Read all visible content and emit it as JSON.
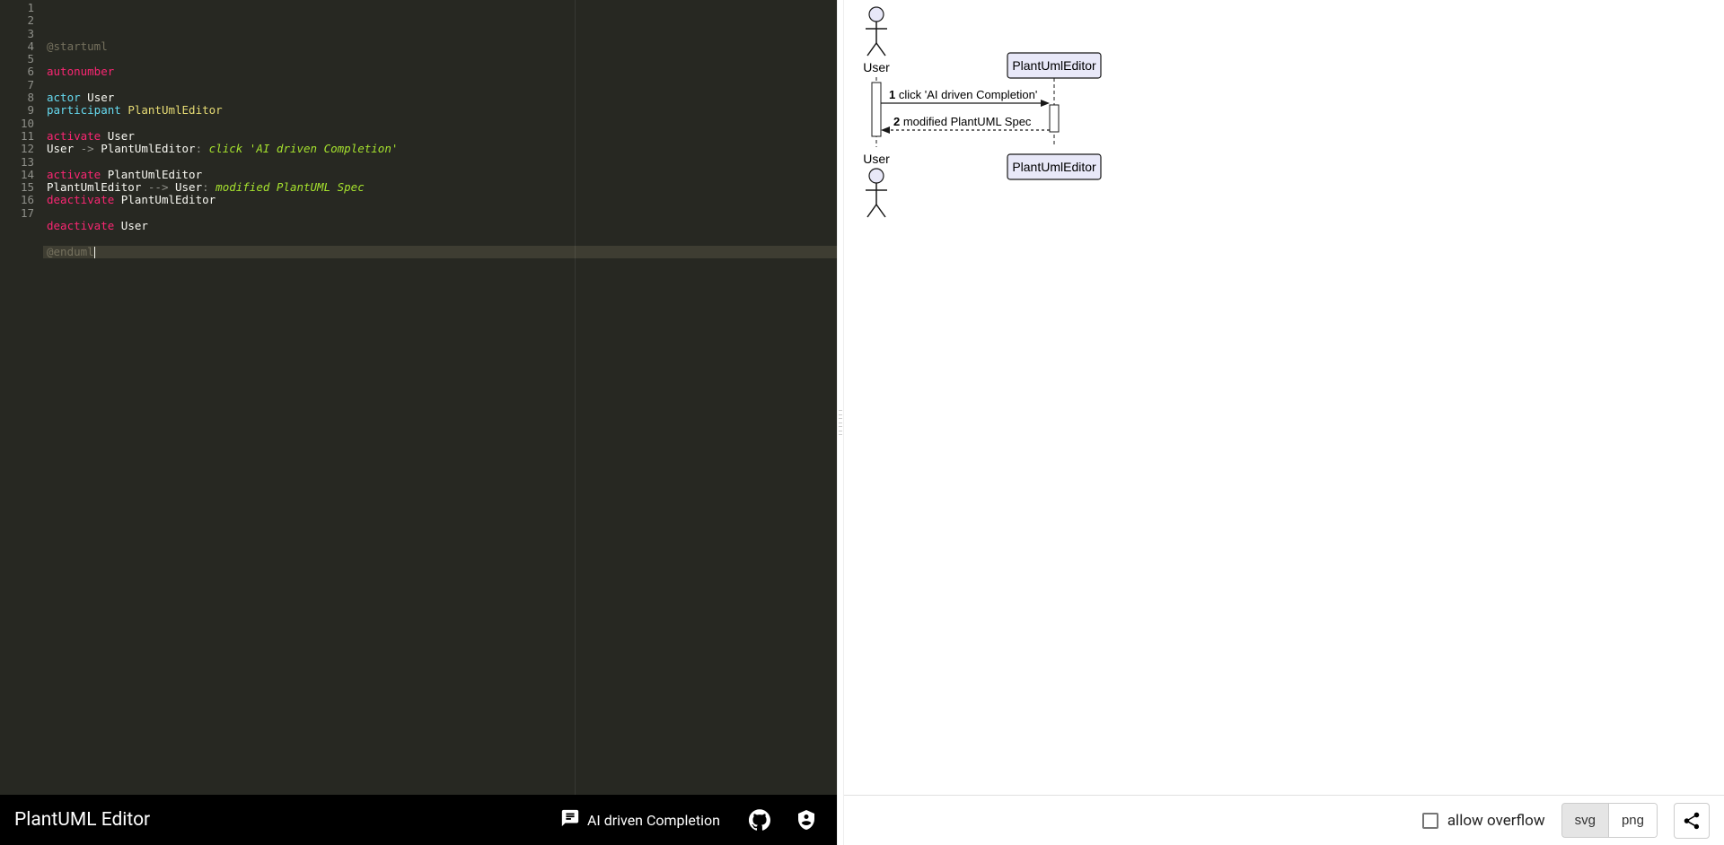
{
  "editor": {
    "title": "PlantUML Editor",
    "ai_button": "AI driven Completion",
    "lines": {
      "1": {
        "tokens": [
          {
            "c": "tk-tag",
            "t": "@startuml"
          }
        ]
      },
      "2": {
        "tokens": []
      },
      "3": {
        "tokens": [
          {
            "c": "tk-kw",
            "t": "autonumber"
          }
        ]
      },
      "4": {
        "tokens": []
      },
      "5": {
        "tokens": [
          {
            "c": "tk-kw2",
            "t": "actor"
          },
          {
            "c": "",
            "t": " "
          },
          {
            "c": "tk-ident",
            "t": "User"
          }
        ]
      },
      "6": {
        "tokens": [
          {
            "c": "tk-kw2",
            "t": "participant"
          },
          {
            "c": "",
            "t": " "
          },
          {
            "c": "tk-name",
            "t": "PlantUmlEditor"
          }
        ]
      },
      "7": {
        "tokens": []
      },
      "8": {
        "tokens": [
          {
            "c": "tk-kw",
            "t": "activate"
          },
          {
            "c": "",
            "t": " "
          },
          {
            "c": "tk-ident",
            "t": "User"
          }
        ]
      },
      "9": {
        "tokens": [
          {
            "c": "tk-ident",
            "t": "User "
          },
          {
            "c": "tk-arrow",
            "t": "->"
          },
          {
            "c": "tk-ident",
            "t": " PlantUmlEditor"
          },
          {
            "c": "tk-arrow",
            "t": ": "
          },
          {
            "c": "tk-msg",
            "t": "click 'AI driven Completion'"
          }
        ]
      },
      "10": {
        "tokens": []
      },
      "11": {
        "tokens": [
          {
            "c": "tk-kw",
            "t": "activate"
          },
          {
            "c": "",
            "t": " "
          },
          {
            "c": "tk-ident",
            "t": "PlantUmlEditor"
          }
        ]
      },
      "12": {
        "tokens": [
          {
            "c": "tk-ident",
            "t": "PlantUmlEditor "
          },
          {
            "c": "tk-arrow",
            "t": "-->"
          },
          {
            "c": "tk-ident",
            "t": " User"
          },
          {
            "c": "tk-arrow",
            "t": ": "
          },
          {
            "c": "tk-msg",
            "t": "modified PlantUML Spec"
          }
        ]
      },
      "13": {
        "tokens": [
          {
            "c": "tk-kw",
            "t": "deactivate"
          },
          {
            "c": "",
            "t": " "
          },
          {
            "c": "tk-ident",
            "t": "PlantUmlEditor"
          }
        ]
      },
      "14": {
        "tokens": []
      },
      "15": {
        "tokens": [
          {
            "c": "tk-kw",
            "t": "deactivate"
          },
          {
            "c": "",
            "t": " "
          },
          {
            "c": "tk-ident",
            "t": "User"
          }
        ]
      },
      "16": {
        "tokens": []
      },
      "17": {
        "tokens": [
          {
            "c": "tk-tag",
            "t": "@enduml"
          }
        ],
        "active": true,
        "cursor": true
      }
    },
    "line_count": 17
  },
  "diagram": {
    "actor_label": "User",
    "participant_label": "PlantUmlEditor",
    "msg1_num": "1",
    "msg1_text": " click 'AI driven Completion'",
    "msg2_num": "2",
    "msg2_text": " modified PlantUML Spec"
  },
  "preview": {
    "overflow_label": "allow overflow",
    "fmt_svg": "svg",
    "fmt_png": "png"
  }
}
